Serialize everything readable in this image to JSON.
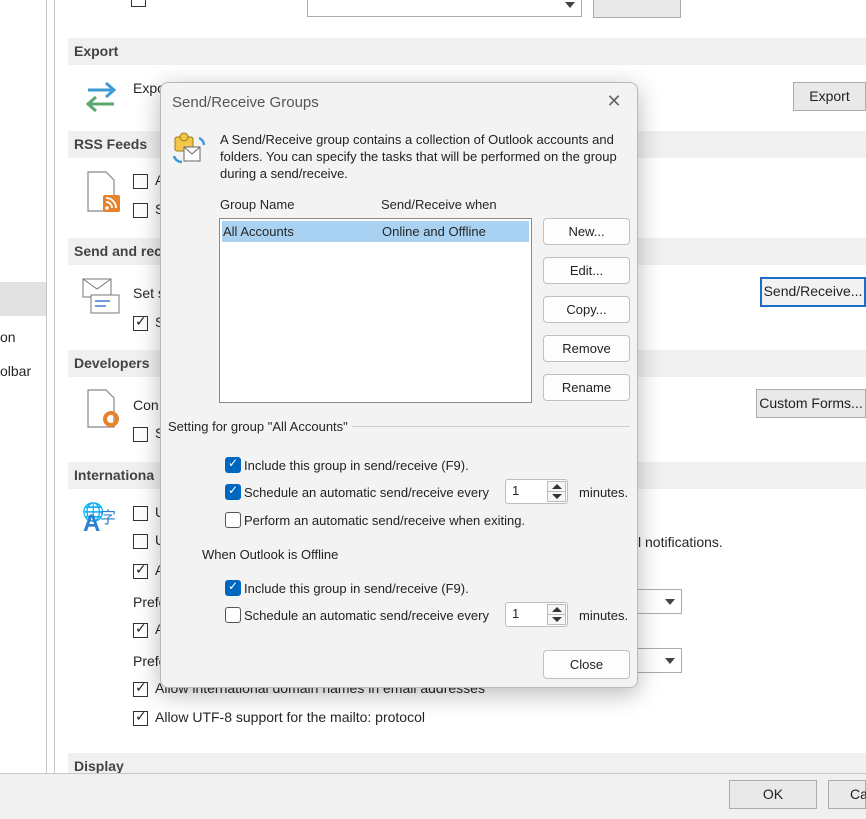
{
  "left_nav": {
    "items": [
      "on",
      "olbar"
    ]
  },
  "options": {
    "export": {
      "header": "Export",
      "desc": "Expo",
      "button": "Export"
    },
    "rss": {
      "header": "RSS Feeds",
      "opt1": "A",
      "opt2": "S"
    },
    "send": {
      "header": "Send and rec",
      "desc": "Set s",
      "opt1": "S",
      "button": "Send/Receive..."
    },
    "developers": {
      "header": "Developers",
      "desc": "Con",
      "opt1": "S",
      "button": "Custom Forms..."
    },
    "international": {
      "header": "Internationa",
      "opt1": "U",
      "opt2": "U",
      "opt3": "A",
      "pref1": "Prefe",
      "opt4": "A",
      "pref2": "Prefe",
      "notifications_tail": "l notifications.",
      "idn": "Allow international domain names in email addresses",
      "utf8": "Allow UTF-8 support for the mailto: protocol"
    },
    "display": {
      "header": "Display"
    },
    "ok": "OK",
    "cancel": "Ca"
  },
  "dialog": {
    "title": "Send/Receive Groups",
    "description": "A Send/Receive group contains a collection of Outlook accounts and folders. You can specify the tasks that will be performed on the group during a send/receive.",
    "col_group_name": "Group Name",
    "col_when": "Send/Receive when",
    "rows": [
      {
        "name": "All Accounts",
        "when": "Online and Offline"
      }
    ],
    "buttons": {
      "new": "New...",
      "edit": "Edit...",
      "copy": "Copy...",
      "remove": "Remove",
      "rename": "Rename",
      "close": "Close"
    },
    "settings_caption": "Setting for group \"All Accounts\"",
    "online": {
      "include": "Include this group in send/receive (F9).",
      "schedule": "Schedule an automatic send/receive every",
      "interval": "1",
      "minutes": "minutes.",
      "exiting": "Perform an automatic send/receive when exiting."
    },
    "offline_caption": "When Outlook is Offline",
    "offline": {
      "include": "Include this group in send/receive (F9).",
      "schedule": "Schedule an automatic send/receive every",
      "interval": "1",
      "minutes": "minutes."
    }
  }
}
